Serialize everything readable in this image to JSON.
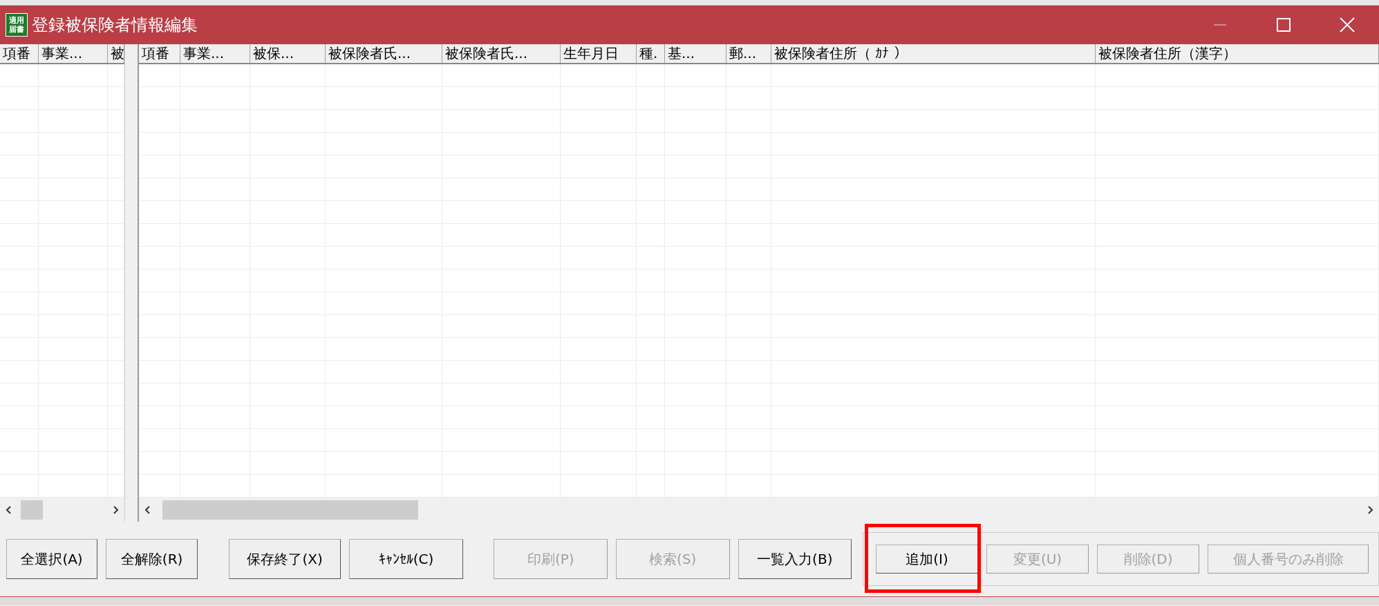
{
  "window": {
    "title": "登録被保険者情報編集",
    "icon_text": [
      "適用",
      "届書"
    ]
  },
  "left_table": {
    "columns": [
      "項番",
      "事業...",
      "被"
    ]
  },
  "right_table": {
    "columns": [
      "項番",
      "事業...",
      "被保...",
      "被保険者氏...",
      "被保険者氏...",
      "生年月日",
      "種.",
      "基...",
      "郵...",
      "被保険者住所（ ｶﾅ ）",
      "被保険者住所（漢字）"
    ]
  },
  "buttons": [
    {
      "label": "全選択(A)",
      "disabled": false
    },
    {
      "label": "全解除(R)",
      "disabled": false
    },
    {
      "label": "保存終了(X)",
      "disabled": false
    },
    {
      "label": "ｷｬﾝｾﾙ(C)",
      "disabled": false
    },
    {
      "label": "印刷(P)",
      "disabled": true
    },
    {
      "label": "検索(S)",
      "disabled": true
    },
    {
      "label": "一覧入力(B)",
      "disabled": false
    }
  ],
  "action_buttons": [
    {
      "label": "追加(I)",
      "disabled": false,
      "highlighted": true
    },
    {
      "label": "変更(U)",
      "disabled": true,
      "highlighted": false
    },
    {
      "label": "削除(D)",
      "disabled": true,
      "highlighted": false
    },
    {
      "label": "個人番号のみ削除",
      "disabled": true,
      "highlighted": false
    }
  ]
}
